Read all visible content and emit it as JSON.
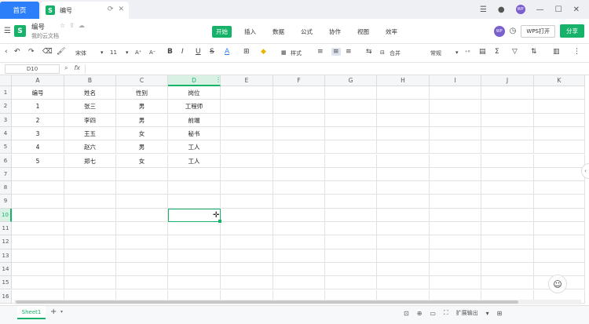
{
  "titlebar": {
    "home_tab": "首页",
    "doc_tab": "编号",
    "tab_logo": "S"
  },
  "menubar": {
    "file_name": "编号",
    "file_location": "我的云文档",
    "file_logo": "S",
    "menus": [
      {
        "label": "开始",
        "active": true
      },
      {
        "label": "插入",
        "active": false
      },
      {
        "label": "数据",
        "active": false
      },
      {
        "label": "公式",
        "active": false
      },
      {
        "label": "协作",
        "active": false
      },
      {
        "label": "视图",
        "active": false
      },
      {
        "label": "效率",
        "active": false
      }
    ],
    "avatar_text": "WP",
    "wps_open": "WPS打开",
    "share": "分享"
  },
  "toolbar": {
    "font_name": "宋体",
    "font_size": "11",
    "bold": "B",
    "italic": "I",
    "underline": "U",
    "strike": "S",
    "font_color": "A",
    "style_label": "样式",
    "merge_label": "合并",
    "number_format": "常规"
  },
  "formula": {
    "cell_ref": "D10",
    "fx": "fx"
  },
  "grid": {
    "columns": [
      "A",
      "B",
      "C",
      "D",
      "E",
      "F",
      "G",
      "H",
      "I",
      "J",
      "K"
    ],
    "rows": [
      "1",
      "2",
      "3",
      "4",
      "5",
      "6",
      "7",
      "8",
      "9",
      "10",
      "11",
      "12",
      "13",
      "14",
      "15",
      "16"
    ],
    "cells": [
      [
        "编号",
        "姓名",
        "性别",
        "岗位"
      ],
      [
        "1",
        "张三",
        "男",
        "工程师"
      ],
      [
        "2",
        "李四",
        "男",
        "前端"
      ],
      [
        "3",
        "王五",
        "女",
        "秘书"
      ],
      [
        "4",
        "赵六",
        "男",
        "工人"
      ],
      [
        "5",
        "郑七",
        "女",
        "工人"
      ]
    ],
    "selected_column": "D",
    "selected_row": "10"
  },
  "statusbar": {
    "sheet_name": "Sheet1",
    "add": "+",
    "expand": "扩展输出"
  }
}
